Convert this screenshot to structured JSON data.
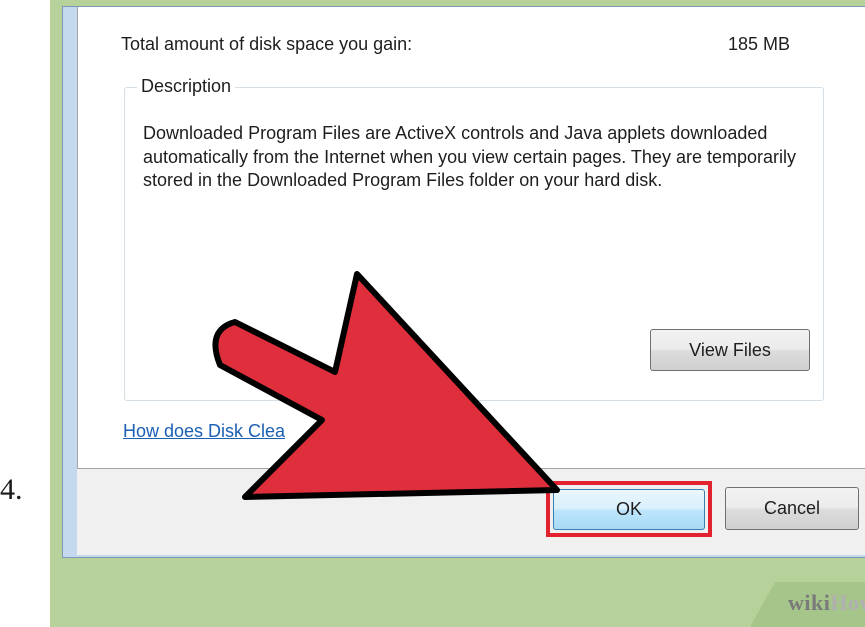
{
  "step": {
    "number": "4."
  },
  "dialog": {
    "gain_label": "Total amount of disk space you gain:",
    "gain_value": "185 MB",
    "description": {
      "legend": "Description",
      "body": "Downloaded Program Files are ActiveX controls and Java applets downloaded automatically from the Internet when you view certain pages. They are temporarily stored in the Downloaded Program Files folder on your hard disk."
    },
    "view_files_label": "View Files",
    "help_link": "How does Disk Clea",
    "ok_label": "OK",
    "cancel_label": "Cancel"
  },
  "annotation": {
    "arrow_color": "#e02f3c",
    "highlight_color": "#e2232f"
  },
  "watermark": {
    "part1": "wiki",
    "part2": "How"
  }
}
